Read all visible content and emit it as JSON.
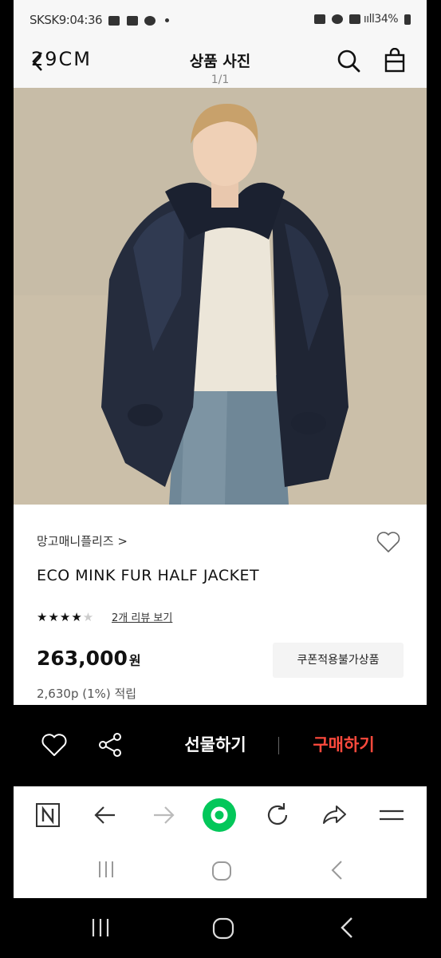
{
  "status_bar": {
    "left_text": "SKSK9:04:36",
    "right_text": "ııll34%"
  },
  "header": {
    "logo": "29CM",
    "title": "상품 사진",
    "count": "1/1"
  },
  "product": {
    "brand": "망고매니플리즈 >",
    "name": "ECO MINK FUR HALF JACKET",
    "rating_stars_filled": "★★★★",
    "rating_stars_empty": "★",
    "review_link": "2개 리뷰 보기",
    "price": "263,000",
    "currency": "원",
    "coupon_label": "쿠폰적용불가상품",
    "points": "2,630p (1%) 적립"
  },
  "actions": {
    "gift_label": "선물하기",
    "buy_label": "구매하기",
    "buy_color": "#ff4a3d"
  },
  "browser_bar": {
    "icons": [
      "naver-n-icon",
      "back-arrow-icon",
      "forward-arrow-icon",
      "home-circle-icon",
      "refresh-icon",
      "share-arrow-icon",
      "menu-icon"
    ],
    "accent": "#03c75a"
  }
}
